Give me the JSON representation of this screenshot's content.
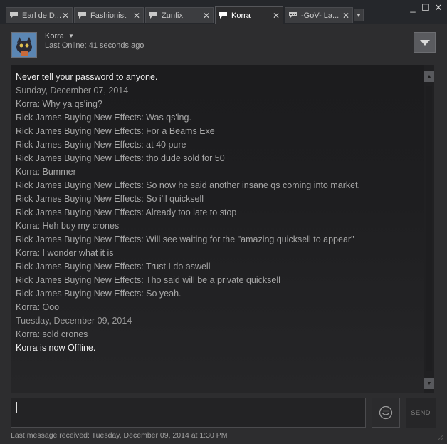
{
  "tabs": [
    {
      "label": "Earl de D...",
      "icon": "chat-bubble-icon",
      "active": false
    },
    {
      "label": "Fashionist",
      "icon": "chat-bubble-icon",
      "active": false
    },
    {
      "label": "Zunfix",
      "icon": "chat-bubble-icon",
      "active": false
    },
    {
      "label": "Korra",
      "icon": "chat-bubble-icon",
      "active": true
    },
    {
      "label": "-GoV- La...",
      "icon": "group-chat-icon",
      "active": false
    }
  ],
  "tab_close_glyph": "✕",
  "window_controls": {
    "minimize": "_",
    "maximize": "☐",
    "close": "✕"
  },
  "friend": {
    "name": "Korra",
    "status": "Last Online: 41 seconds ago"
  },
  "messages": [
    {
      "type": "warn",
      "text": "Never tell your password to anyone."
    },
    {
      "type": "date",
      "text": "Sunday, December 07, 2014"
    },
    {
      "type": "msg",
      "text": "Korra: Why ya qs'ing?"
    },
    {
      "type": "msg",
      "text": "Rick James Buying New Effects: Was qs'ing."
    },
    {
      "type": "msg",
      "text": "Rick James Buying New Effects: For a Beams Exe"
    },
    {
      "type": "msg",
      "text": "Rick James Buying New Effects: at 40 pure"
    },
    {
      "type": "msg",
      "text": "Rick James Buying New Effects: tho dude sold for 50"
    },
    {
      "type": "msg",
      "text": "Korra: Bummer"
    },
    {
      "type": "msg",
      "text": "Rick James Buying New Effects: So now he said another insane qs coming into market."
    },
    {
      "type": "msg",
      "text": "Rick James Buying New Effects: So i'll quicksell"
    },
    {
      "type": "msg",
      "text": "Rick James Buying New Effects: Already too late to stop"
    },
    {
      "type": "msg",
      "text": "Korra: Heh buy my crones"
    },
    {
      "type": "msg",
      "text": "Rick James Buying New Effects: Will see waiting for the \"amazing quicksell to appear\""
    },
    {
      "type": "msg",
      "text": "Korra: I wonder what it is"
    },
    {
      "type": "msg",
      "text": "Rick James Buying New Effects: Trust I do aswell"
    },
    {
      "type": "msg",
      "text": "Rick James Buying New Effects: Tho said will be a private quicksell"
    },
    {
      "type": "msg",
      "text": "Rick James Buying New Effects: So yeah."
    },
    {
      "type": "msg",
      "text": "Korra: Ooo"
    },
    {
      "type": "date",
      "text": "Tuesday, December 09, 2014"
    },
    {
      "type": "msg",
      "text": "Korra: sold crones"
    },
    {
      "type": "event",
      "text": "Korra is now Offline."
    }
  ],
  "composer": {
    "value": "",
    "send_label": "SEND"
  },
  "footer": {
    "text": "Last message received: Tuesday, December 09, 2014 at 1:30 PM"
  },
  "colors": {
    "background": "#2d2d2f",
    "chat_bg": "#1c1c1e",
    "message_text": "#a7a7a7",
    "highlight_text": "#f2f2f2"
  }
}
